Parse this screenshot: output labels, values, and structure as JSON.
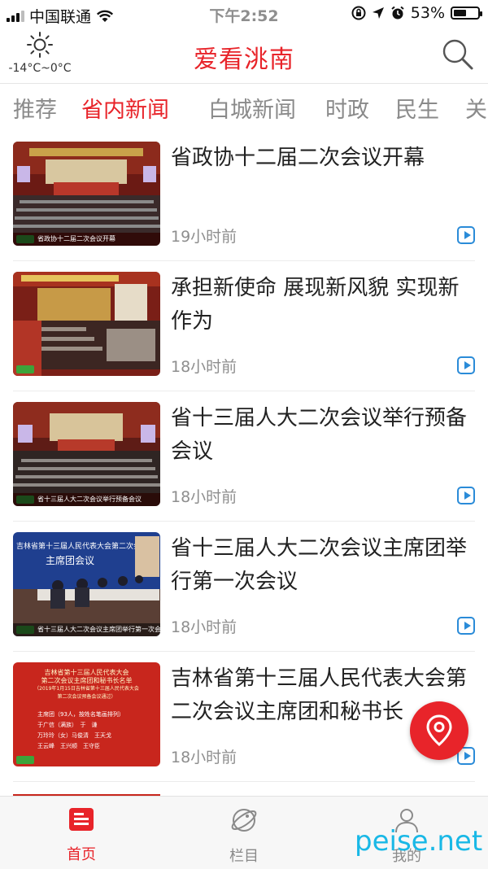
{
  "status_bar": {
    "carrier": "中国联通",
    "time": "下午2:52",
    "battery": "53%"
  },
  "header": {
    "title": "爱看洮南",
    "weather_temp": "-14°C~0°C"
  },
  "tabs": [
    {
      "label": "推荐"
    },
    {
      "label": "省内新闻",
      "active": true
    },
    {
      "label": "白城新闻"
    },
    {
      "label": "时政"
    },
    {
      "label": "民生"
    },
    {
      "label": "关"
    }
  ],
  "news": [
    {
      "title": "省政协十二届二次会议开幕",
      "time": "19小时前",
      "caption": "省政协十二届二次会议开幕"
    },
    {
      "title": "承担新使命 展现新风貌 实现新作为",
      "time": "18小时前",
      "caption": ""
    },
    {
      "title": "省十三届人大二次会议举行预备会议",
      "time": "18小时前",
      "caption": "省十三届人大二次会议举行预备会议"
    },
    {
      "title": "省十三届人大二次会议主席团举行第一次会议",
      "time": "18小时前",
      "caption": "省十三届人大二次会议主席团举行第一次会议"
    },
    {
      "title": "吉林省第十三届人民代表大会第二次会议主席团和秘书长",
      "time": "18小时前",
      "caption": ""
    }
  ],
  "thumb4": {
    "banner1": "吉林省第十三届人民代表大会第二次会议",
    "banner2": "主席团会议"
  },
  "thumb5": {
    "line1": "吉林省第十三届人民代表大会",
    "line2": "第二次会议主席团和秘书长名单",
    "line3": "（2019年1月15日吉林省第十三届人民代表大会",
    "line4": "第二次会议预备会议通过）",
    "line5": "主席团（93人，按姓名笔画排列）",
    "line6": "于广信（满族）　于　谦",
    "line7": "万玲玲（女）马俊清　王天戈",
    "line8": "王云峰　王兴顺　王守臣"
  },
  "bottom_nav": [
    {
      "label": "首页",
      "active": true
    },
    {
      "label": "栏目"
    },
    {
      "label": "我的"
    }
  ],
  "watermark": "peise.net",
  "colors": {
    "accent": "#e8242a",
    "link_blue": "#2a8bd8"
  }
}
